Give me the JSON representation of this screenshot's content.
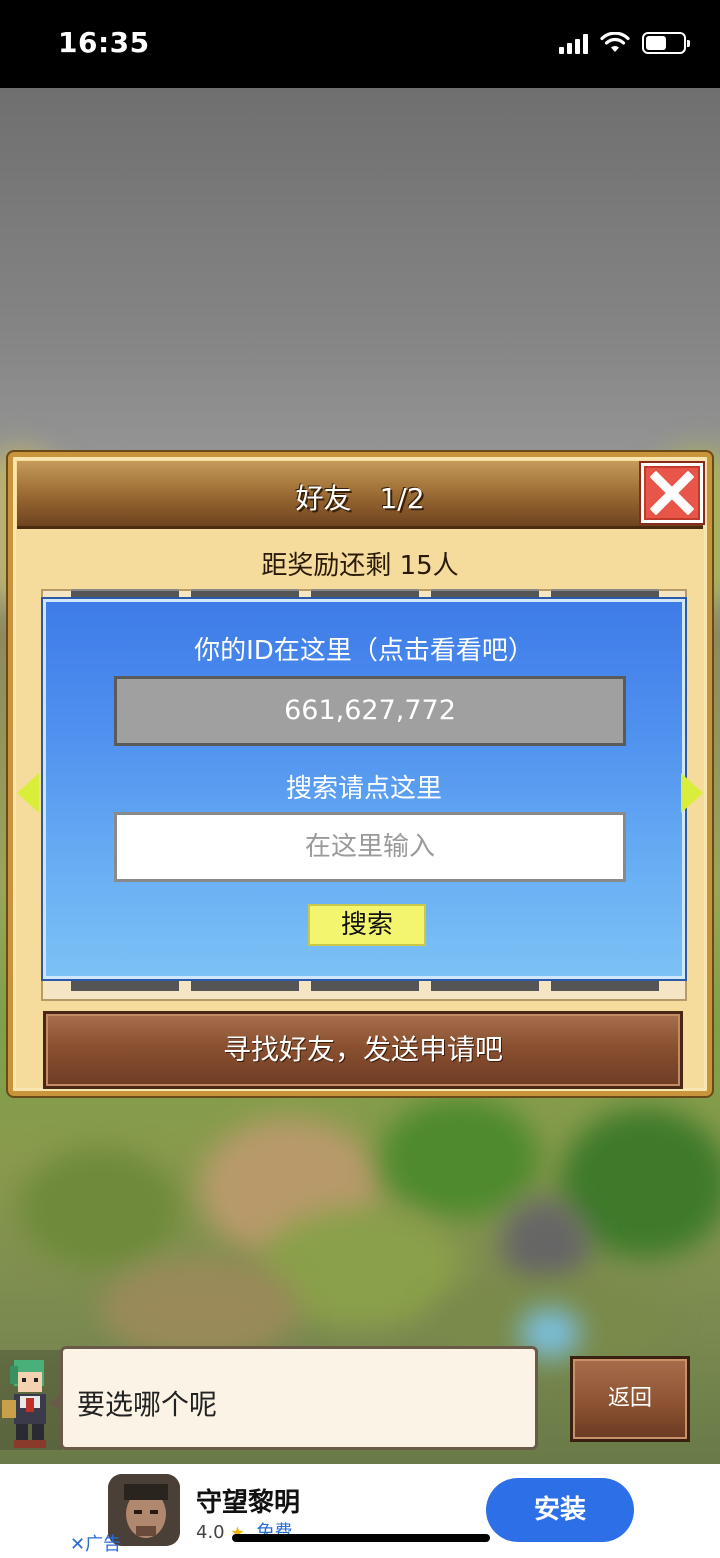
{
  "status_bar": {
    "time": "16:35"
  },
  "dialog": {
    "title": "好友　1/2",
    "reward_text": "距奖励还剩 15人",
    "id_label": "你的ID在这里（点击看看吧）",
    "id_value": "661,627,772",
    "search_label": "搜索请点这里",
    "search_placeholder": "在这里输入",
    "search_button": "搜索",
    "find_button": "寻找好友，发送申请吧"
  },
  "speech": {
    "text": "要选哪个呢"
  },
  "back_button": "返回",
  "ad": {
    "app_name": "守望黎明",
    "rating": "4.0",
    "price": "免费",
    "label": "广告",
    "install": "安装"
  },
  "icons": [
    "signal-icon",
    "wifi-icon",
    "battery-icon",
    "close-icon",
    "arrow-left-icon",
    "arrow-right-icon",
    "star-icon",
    "ad-close-icon"
  ]
}
